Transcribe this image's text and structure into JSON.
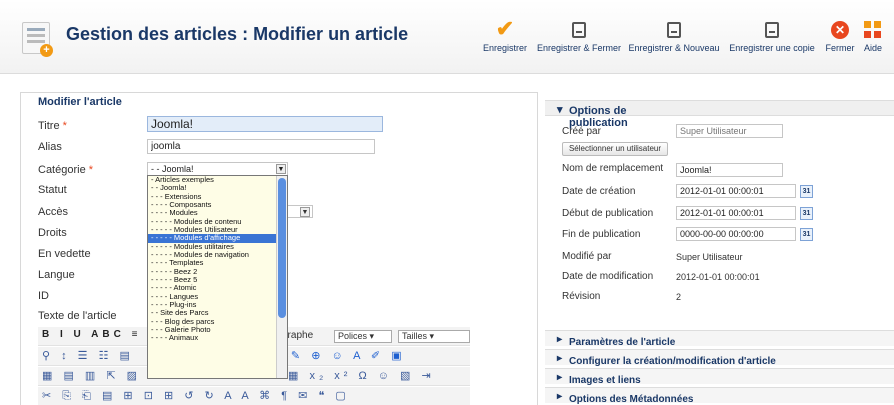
{
  "header": {
    "title": "Gestion des articles : Modifier un article",
    "toolbar": {
      "save": "Enregistrer",
      "save_close": "Enregistrer & Fermer",
      "save_new": "Enregistrer & Nouveau",
      "save_copy": "Enregistrer une copie",
      "close": "Fermer",
      "help": "Aide"
    }
  },
  "form": {
    "legend": "Modifier l'article",
    "labels": {
      "title": "Titre",
      "alias": "Alias",
      "category": "Catégorie",
      "status": "Statut",
      "access": "Accès",
      "rights": "Droits",
      "featured": "En vedette",
      "language": "Langue",
      "id": "ID",
      "text": "Texte de l'article"
    },
    "required_mark": "*",
    "title_value": "Joomla!",
    "alias_value": "joomla",
    "category_selected": "- - Joomla!",
    "category_options": [
      "- Articles exemples",
      "- - Joomla!",
      "- - - Extensions",
      "- - - - Composants",
      "- - - - Modules",
      "- - - - - Modules de contenu",
      "- - - - - Modules Utilisateur",
      "- - - - - Modules d'affichage",
      "- - - - - Modules utilitaires",
      "- - - - - Modules de navigation",
      "- - - - Templates",
      "- - - - - Beez 2",
      "- - - - - Beez 5",
      "- - - - - Atomic",
      "- - - - Langues",
      "- - - - Plug-ins",
      "- - Site des Parcs",
      "- - - Blog des parcs",
      "- - - Galerie Photo",
      "- - - - Animaux"
    ],
    "category_highlight_index": 7,
    "editor": {
      "paragraph_fragment": "graphe",
      "fonts_select": "Polices",
      "sizes_select": "Tailles"
    }
  },
  "publish": {
    "heading": "Options de publication",
    "created_by_label": "Créé par",
    "created_by_value": "Super Utilisateur",
    "select_user_button": "Sélectionner un utilisateur",
    "alias_label": "Nom de remplacement",
    "alias_value": "Joomla!",
    "created_date_label": "Date de création",
    "created_date_value": "2012-01-01 00:00:01",
    "publish_up_label": "Début de publication",
    "publish_up_value": "2012-01-01 00:00:01",
    "publish_down_label": "Fin de publication",
    "publish_down_value": "0000-00-00 00:00:00",
    "modified_by_label": "Modifié par",
    "modified_by_value": "Super Utilisateur",
    "modified_date_label": "Date de modification",
    "modified_date_value": "2012-01-01 00:00:01",
    "revision_label": "Révision",
    "revision_value": "2",
    "calendar_icon_text": "31"
  },
  "accordion": [
    "Paramètres de l'article",
    "Configurer la création/modification d'article",
    "Images et liens",
    "Options des Métadonnées"
  ],
  "colors": {
    "title_blue": "#1a3867",
    "accent_orange": "#f29a14",
    "close_red": "#e8471f",
    "selection_blue": "#3a74d4"
  }
}
